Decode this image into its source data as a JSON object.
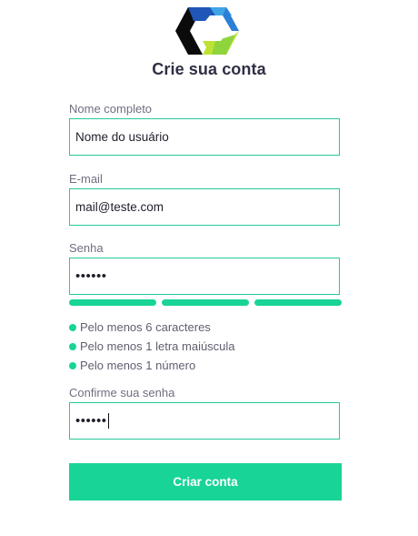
{
  "title": "Crie sua conta",
  "colors": {
    "accent": "#18d497",
    "border": "#26c99a",
    "label": "#6f6f80",
    "title": "#2f2f45"
  },
  "logo": {
    "icon": "hexagon-c-logo"
  },
  "fields": {
    "name": {
      "label": "Nome completo",
      "value": "Nome do usuário"
    },
    "email": {
      "label": "E-mail",
      "value": "mail@teste.com"
    },
    "password": {
      "label": "Senha",
      "value": "••••••"
    },
    "confirm": {
      "label": "Confirme sua senha",
      "value": "••••••"
    }
  },
  "strength": {
    "filled": 3,
    "total": 3
  },
  "rules": [
    {
      "text": "Pelo menos 6 caracteres"
    },
    {
      "text": "Pelo menos 1 letra maiúscula"
    },
    {
      "text": "Pelo menos 1 número"
    }
  ],
  "submit": {
    "label": "Criar conta"
  }
}
